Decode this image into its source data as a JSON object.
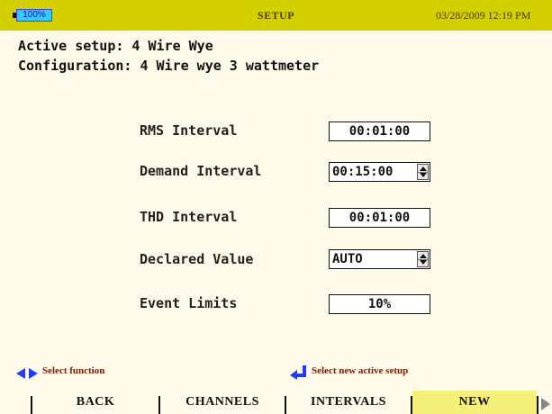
{
  "titlebar": {
    "battery_level": "100%",
    "title": "SETUP",
    "datetime": "03/28/2009 12:19 PM"
  },
  "info": {
    "active_setup": "Active setup: 4 Wire Wye",
    "configuration": "Configuration: 4 Wire wye 3 wattmeter"
  },
  "settings": {
    "rms_interval": {
      "label": "RMS Interval",
      "value": "00:01:00"
    },
    "demand_interval": {
      "label": "Demand Interval",
      "value": "00:15:00"
    },
    "thd_interval": {
      "label": "THD Interval",
      "value": "00:01:00"
    },
    "declared_value": {
      "label": "Declared Value",
      "value": "AUTO"
    },
    "event_limits": {
      "label": "Event Limits",
      "value": "10%"
    }
  },
  "hints": {
    "left": "Select function",
    "right": "Select new active setup"
  },
  "function_keys": {
    "back": "BACK",
    "channels": "CHANNELS",
    "intervals": "INTERVALS",
    "new": "NEW"
  },
  "colors": {
    "titlebar": "#d4cf00",
    "background": "#fffbeb",
    "active_key": "#f5f07a",
    "hint_text": "#7a1a00",
    "hint_icon": "#1e3cff"
  }
}
